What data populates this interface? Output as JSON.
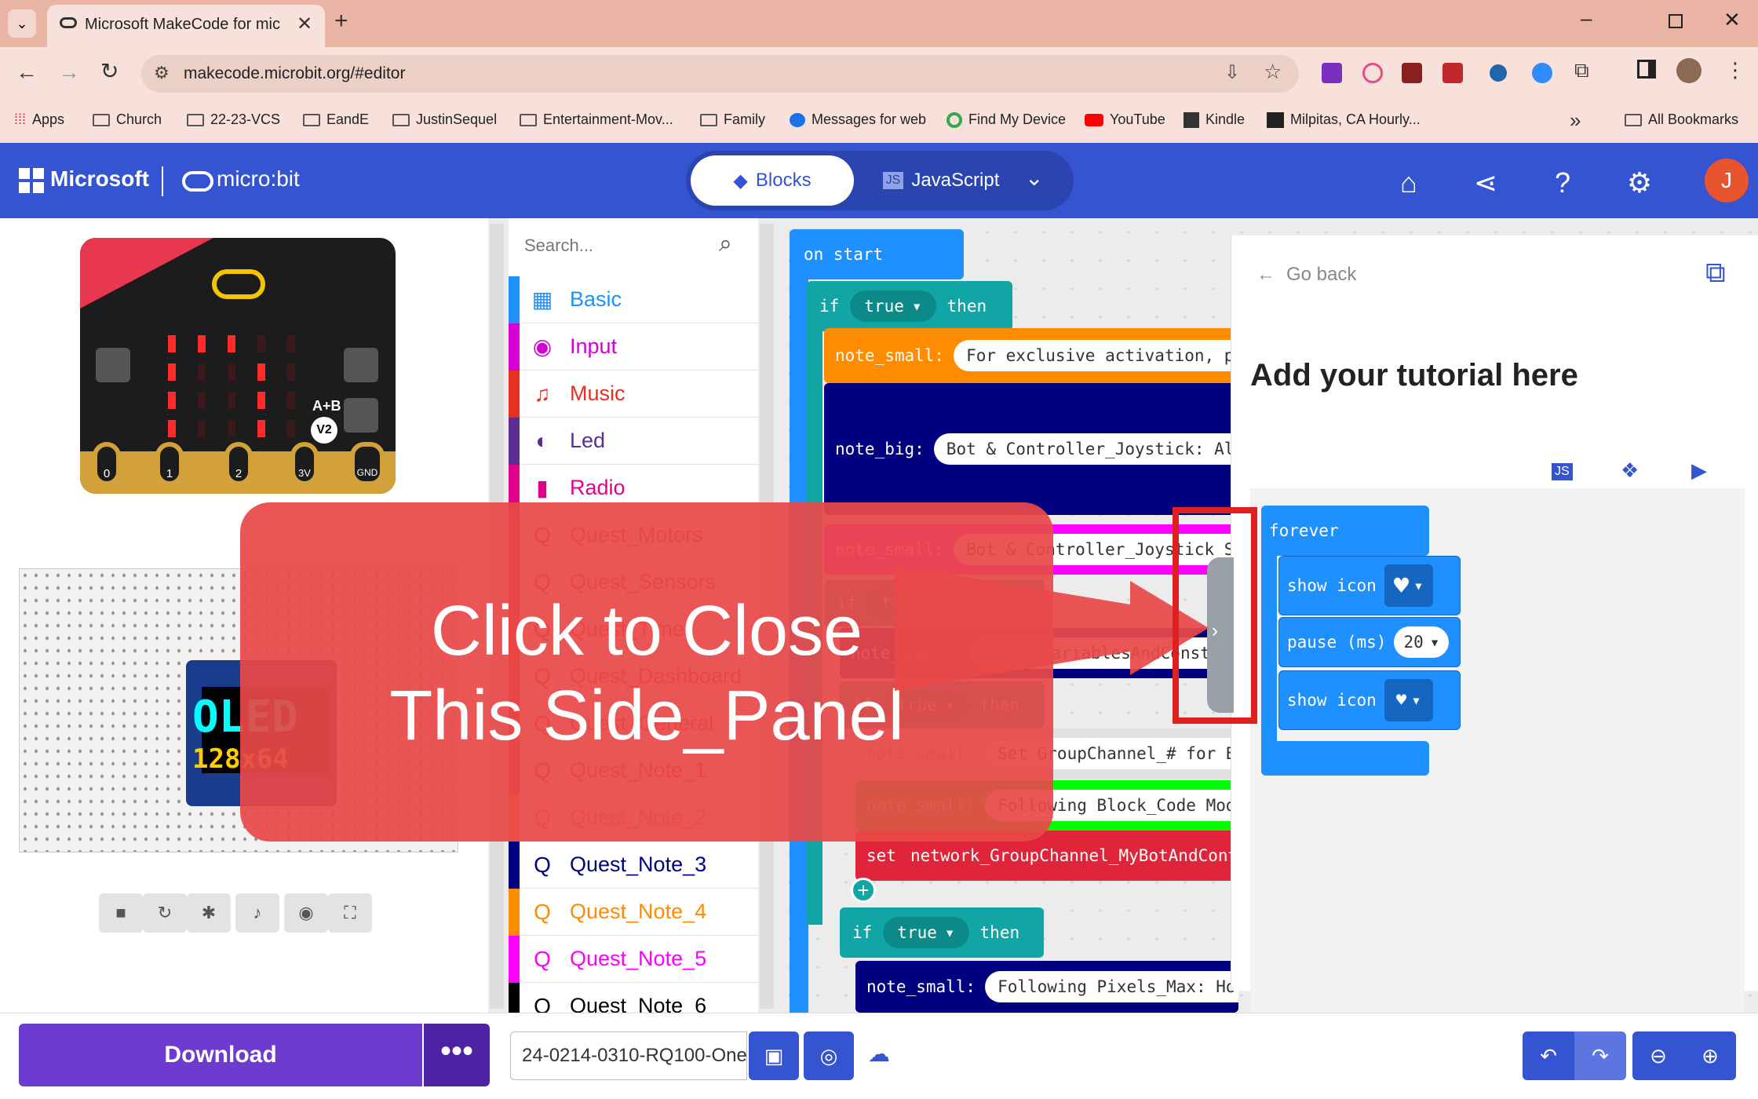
{
  "browser": {
    "tab_title": "Microsoft MakeCode for micro:",
    "url": "makecode.microbit.org/#editor",
    "bookmarks": [
      "Apps",
      "Church",
      "22-23-VCS",
      "EandE",
      "JustinSequel",
      "Entertainment-Mov...",
      "Family",
      "Messages for web",
      "Find My Device",
      "YouTube",
      "Kindle",
      "Milpitas, CA Hourly...",
      "All Bookmarks"
    ]
  },
  "app": {
    "ms_logo": "Microsoft",
    "microbit_logo": "micro:bit",
    "mode_blocks": "Blocks",
    "mode_js": "JavaScript",
    "avatar_letter": "J",
    "accent": "#3454d1"
  },
  "simulator": {
    "pins": [
      "0",
      "1",
      "2",
      "3V",
      "GND"
    ],
    "ab_label": "A+B",
    "version_badge": "V2",
    "oled_line1": "OLED",
    "oled_line2": "128x64"
  },
  "toolbox": {
    "search_placeholder": "Search...",
    "categories": [
      {
        "label": "Basic",
        "color": "#1e90ff"
      },
      {
        "label": "Input",
        "color": "#d400d4"
      },
      {
        "label": "Music",
        "color": "#e63022"
      },
      {
        "label": "Led",
        "color": "#5c2d91"
      },
      {
        "label": "Radio",
        "color": "#e3008c"
      },
      {
        "label": "Quest_Motors",
        "color": "#e63022"
      },
      {
        "label": "Quest_Sensors",
        "color": "#e63022"
      },
      {
        "label": "Quest_Timer",
        "color": "#e63022"
      },
      {
        "label": "Quest_Dashboard",
        "color": "#e63022"
      },
      {
        "label": "Quest_General",
        "color": "#e63022"
      },
      {
        "label": "Quest_Note_1",
        "color": "#e63022"
      },
      {
        "label": "Quest_Note_2",
        "color": "#ff8c00"
      },
      {
        "label": "Quest_Note_3",
        "color": "#000080"
      },
      {
        "label": "Quest_Note_4",
        "color": "#ff8c00"
      },
      {
        "label": "Quest_Note_5",
        "color": "#ff00ff"
      },
      {
        "label": "Quest_Note_6",
        "color": "#000000"
      }
    ]
  },
  "workspace": {
    "on_start": "on start",
    "if_kw": "if",
    "then_kw": "then",
    "true_kw": "true",
    "note_small": "note_small:",
    "note_big": "note_big:",
    "set_kw": "set",
    "str1": "For exclusive activation, pla",
    "str2": "Bot & Controller_Joystick: All_",
    "str3": "Bot & Controller_Joystick Sta",
    "str4": "setup_VariablesAndConstants",
    "str5": "Set GroupChannel_# for Bo",
    "str6": "Following Block_Code Modd",
    "set_var": "network_GroupChannel_MyBotAndContr",
    "str7": "Following Pixels_Max: Hor"
  },
  "tutorial": {
    "go_back": "Go back",
    "title": "Add your tutorial here",
    "forever": "forever",
    "show_icon": "show icon",
    "pause": "pause (ms)",
    "pause_value": "20"
  },
  "overlay": {
    "line1": "Click to Close",
    "line2": "This Side_Panel"
  },
  "bottom": {
    "download": "Download",
    "project_name": "24-0214-0310-RQ100-One"
  }
}
